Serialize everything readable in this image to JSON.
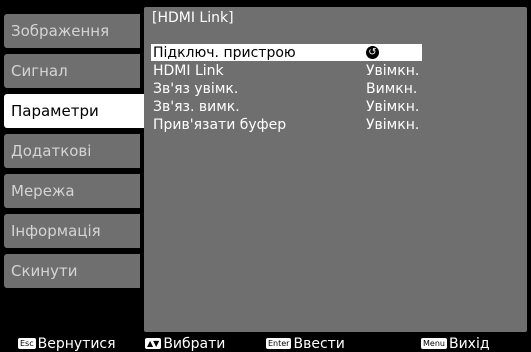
{
  "sidebar": {
    "items": [
      {
        "label": "Зображення"
      },
      {
        "label": "Сигнал"
      },
      {
        "label": "Параметри"
      },
      {
        "label": "Додаткові"
      },
      {
        "label": "Мережа"
      },
      {
        "label": "Інформація"
      },
      {
        "label": "Скинути"
      }
    ],
    "active_index": 2
  },
  "panel": {
    "title": "[HDMI Link]",
    "rows": [
      {
        "label": "Підключ. пристрою",
        "value": "",
        "icon": "enter-icon"
      },
      {
        "label": "HDMI Link",
        "value": "Увімкн."
      },
      {
        "label": "Зв'яз увімк.",
        "value": "Вимкн."
      },
      {
        "label": "Зв'яз. вимк.",
        "value": "Увімкн."
      },
      {
        "label": "Прив'язати буфер",
        "value": "Увімкн."
      }
    ]
  },
  "footer": {
    "back_key": "Esc",
    "back_label": "Вернутися",
    "select_key": "▲▼",
    "select_label": "Вибрати",
    "enter_key": "Enter",
    "enter_label": "Ввести",
    "menu_key": "Menu",
    "menu_label": "Вихід"
  },
  "colors": {
    "panel_bg": "#6f6f6f",
    "active_bg": "#ffffff",
    "screen_bg": "#000000"
  }
}
